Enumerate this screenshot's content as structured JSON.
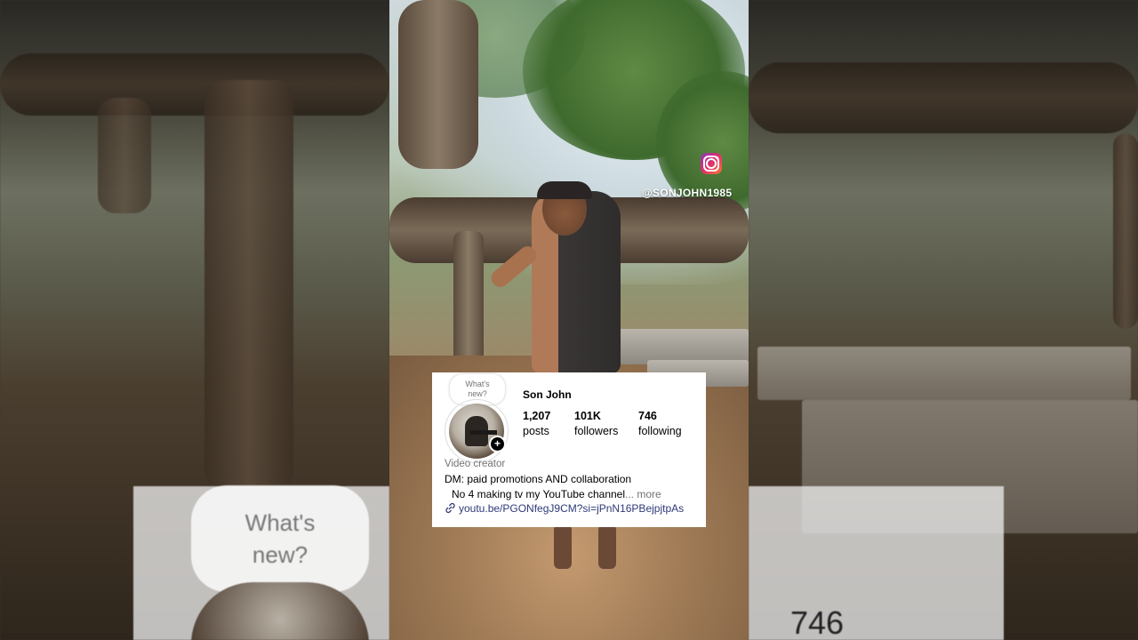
{
  "watermark": {
    "icon": "instagram-icon",
    "handle": "@SONJOHN1985"
  },
  "profile": {
    "bubble_text_line1": "What's",
    "bubble_text_line2": "new?",
    "name": "Son John",
    "stats": [
      {
        "value": "1,207",
        "label": "posts"
      },
      {
        "value": "101K",
        "label": "followers"
      },
      {
        "value": "746",
        "label": "following"
      }
    ],
    "category": "Video creator",
    "bio_line1": "DM: paid promotions AND collaboration",
    "bio_line2": "No 4 making tv my YouTube channel",
    "more_label": "... more",
    "link": "youtu.be/PGONfegJ9CM?si=jPnN16PBejpjtpAs",
    "add_icon": "plus-icon",
    "link_icon": "link-icon"
  },
  "background": {
    "bubble_text_line1": "What's",
    "bubble_text_line2": "new?",
    "following_number": "746"
  }
}
